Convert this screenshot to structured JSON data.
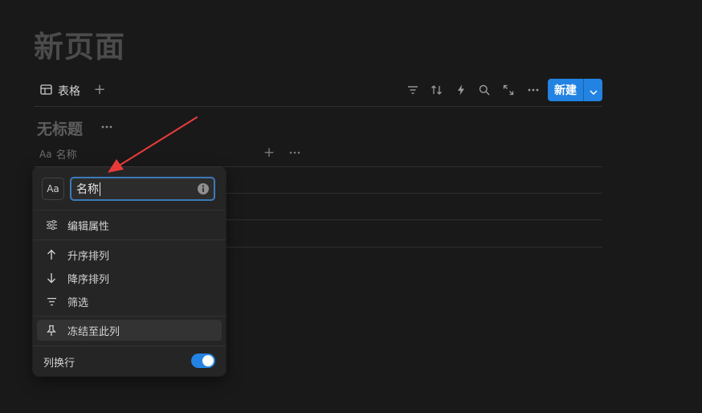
{
  "page": {
    "title": "新页面"
  },
  "view_bar": {
    "tab_label": "表格",
    "new_label": "新建"
  },
  "table": {
    "title": "无标题",
    "column": {
      "type_glyph": "Aa",
      "name": "名称"
    }
  },
  "menu": {
    "type_glyph": "Aa",
    "name_value": "名称",
    "edit_property": "编辑属性",
    "sort_ascending": "升序排列",
    "sort_descending": "降序排列",
    "filter": "筛选",
    "freeze": "冻结至此列",
    "wrap_column": "列换行",
    "wrap_enabled": true
  },
  "colors": {
    "accent": "#2383e2",
    "annotation_arrow": "#e63a3a"
  }
}
